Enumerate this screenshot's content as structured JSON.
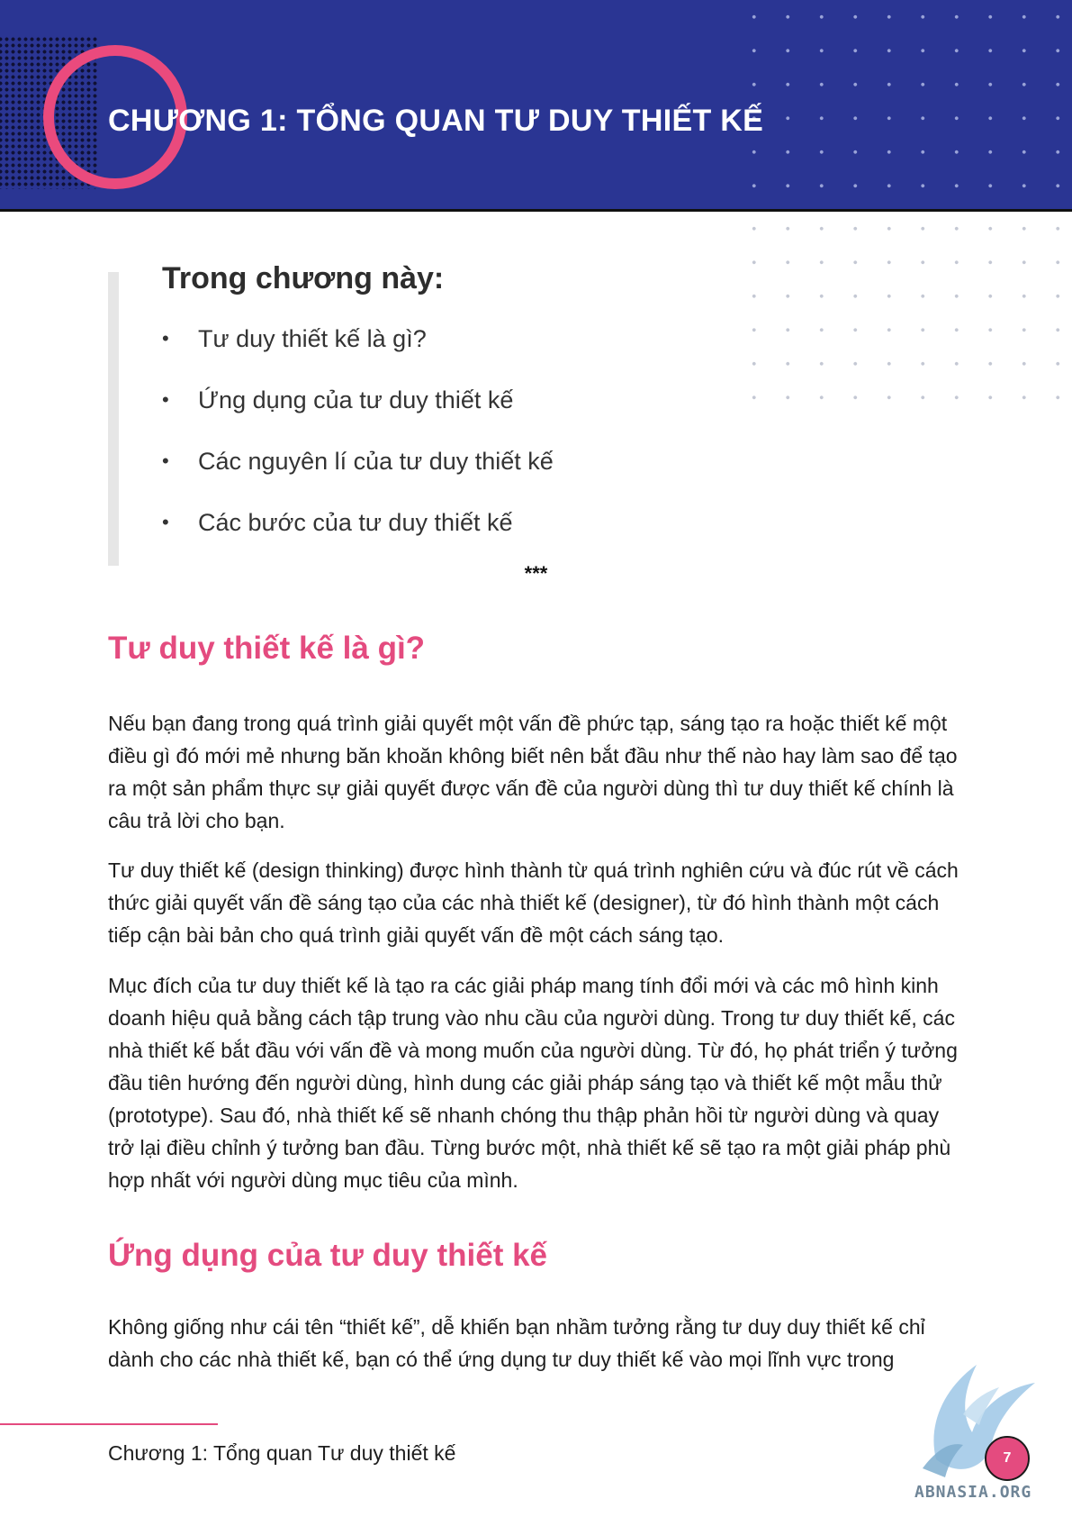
{
  "header": {
    "chapter_title": "CHƯƠNG 1: TỔNG QUAN TƯ DUY THIẾT KẾ"
  },
  "summary": {
    "heading": "Trong chương này:",
    "items": [
      "Tư duy thiết kế là gì?",
      "Ứng dụng của tư duy thiết kế",
      "Các nguyên lí của tư duy thiết kế",
      "Các bước của tư duy thiết kế"
    ],
    "bullet_symbol": "•"
  },
  "separator": "***",
  "section1": {
    "heading": "Tư duy thiết kế là gì?",
    "paragraphs": [
      "Nếu bạn đang trong quá trình giải quyết một vấn đề phức tạp, sáng tạo ra hoặc thiết kế một điều gì đó mới mẻ nhưng băn khoăn không biết nên bắt đầu như thế nào hay làm sao để tạo ra một sản phẩm thực sự giải quyết được vấn đề của người dùng thì tư duy thiết kế chính là câu trả lời cho bạn.",
      "Tư duy thiết kế (design thinking) được hình thành từ quá trình nghiên cứu và đúc rút về cách thức giải quyết vấn đề sáng tạo của các nhà thiết kế (designer), từ đó hình thành một cách tiếp cận bài bản cho quá trình giải quyết vấn đề một cách sáng tạo.",
      "Mục đích của tư duy thiết kế là tạo ra các giải pháp mang tính đổi mới và các mô hình kinh doanh hiệu quả bằng cách tập trung vào nhu cầu của người dùng. Trong tư duy thiết kế, các nhà thiết kế bắt đầu với vấn đề và mong muốn của người dùng. Từ đó, họ phát triển ý tưởng đầu tiên hướng đến người dùng, hình dung các giải pháp sáng tạo và thiết kế một mẫu thử (prototype). Sau đó, nhà thiết kế sẽ nhanh chóng thu thập phản hồi từ người dùng và quay trở lại điều chỉnh ý tưởng ban đầu. Từng bước một, nhà thiết kế sẽ tạo ra một giải pháp phù hợp nhất với người dùng mục tiêu của mình."
    ]
  },
  "section2": {
    "heading": "Ứng dụng của tư duy thiết kế",
    "paragraphs": [
      "Không giống như cái tên “thiết kế”, dễ khiến bạn nhầm tưởng rằng tư duy duy thiết kế chỉ dành cho các nhà thiết kế, bạn có thể ứng dụng tư duy thiết kế vào mọi lĩnh vực trong"
    ]
  },
  "footer": {
    "chapter_label": "Chương 1: Tổng quan Tư duy thiết kế",
    "page_number": "7",
    "watermark": "ABNASIA.ORG"
  },
  "colors": {
    "banner": "#2a3593",
    "accent_pink": "#e44b7f",
    "text": "#1e1e1e"
  }
}
